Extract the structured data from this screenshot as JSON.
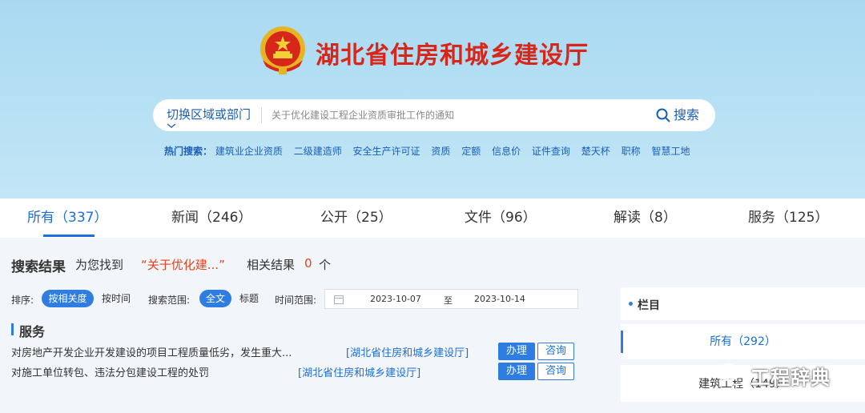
{
  "header": {
    "title": "湖北省住房和城乡建设厅",
    "emblem_icon": "national-emblem-icon",
    "brand_color": "#d7261a"
  },
  "search": {
    "region_label": "切换区域或部门",
    "placeholder": "关于优化建设工程企业资质审批工作的通知",
    "button_label": "搜索"
  },
  "hot": {
    "label": "热门搜索：",
    "items": [
      "建筑业企业资质",
      "二级建造师",
      "安全生产许可证",
      "资质",
      "定额",
      "信息价",
      "证件查询",
      "楚天杯",
      "职称",
      "智慧工地"
    ]
  },
  "tabs": [
    {
      "label": "所有（337）",
      "active": true
    },
    {
      "label": "新闻（246）",
      "active": false
    },
    {
      "label": "公开（25）",
      "active": false
    },
    {
      "label": "文件（96）",
      "active": false
    },
    {
      "label": "解读（8）",
      "active": false
    },
    {
      "label": "服务（125）",
      "active": false
    }
  ],
  "results": {
    "title": "搜索结果",
    "found": "为您找到",
    "query": "“关于优化建...”",
    "related": "相关结果",
    "count": "0",
    "unit": "个"
  },
  "filters": {
    "sort_label": "排序:",
    "sort_options": [
      "按相关度",
      "按时间"
    ],
    "scope_label": "搜索范围:",
    "scope_options": [
      "全文",
      "标题"
    ],
    "time_label": "时间范围:",
    "date_from": "2023-10-07",
    "date_to_label": "至",
    "date_to": "2023-10-14"
  },
  "services": {
    "title": "服务",
    "rows": [
      {
        "text": "对房地产开发企业开发建设的项目工程质量低劣，发生重大...",
        "dept": "[湖北省住房和城乡建设厅]",
        "do": "办理",
        "ask": "咨询"
      },
      {
        "text": "对施工单位转包、违法分包建设工程的处罚",
        "dept": "[湖北省住房和城乡建设厅]",
        "do": "办理",
        "ask": "咨询"
      }
    ]
  },
  "columns": {
    "title": "栏目",
    "items": [
      {
        "label": "所有（292）",
        "active": true
      },
      {
        "label": "建筑工程（149）",
        "active": false
      }
    ]
  },
  "watermark": {
    "text": "工程辞典",
    "icon": "wechat-icon"
  },
  "colors": {
    "accent": "#2f7de1",
    "highlight": "#e8421c",
    "header_bg": "#b8e1f4"
  }
}
